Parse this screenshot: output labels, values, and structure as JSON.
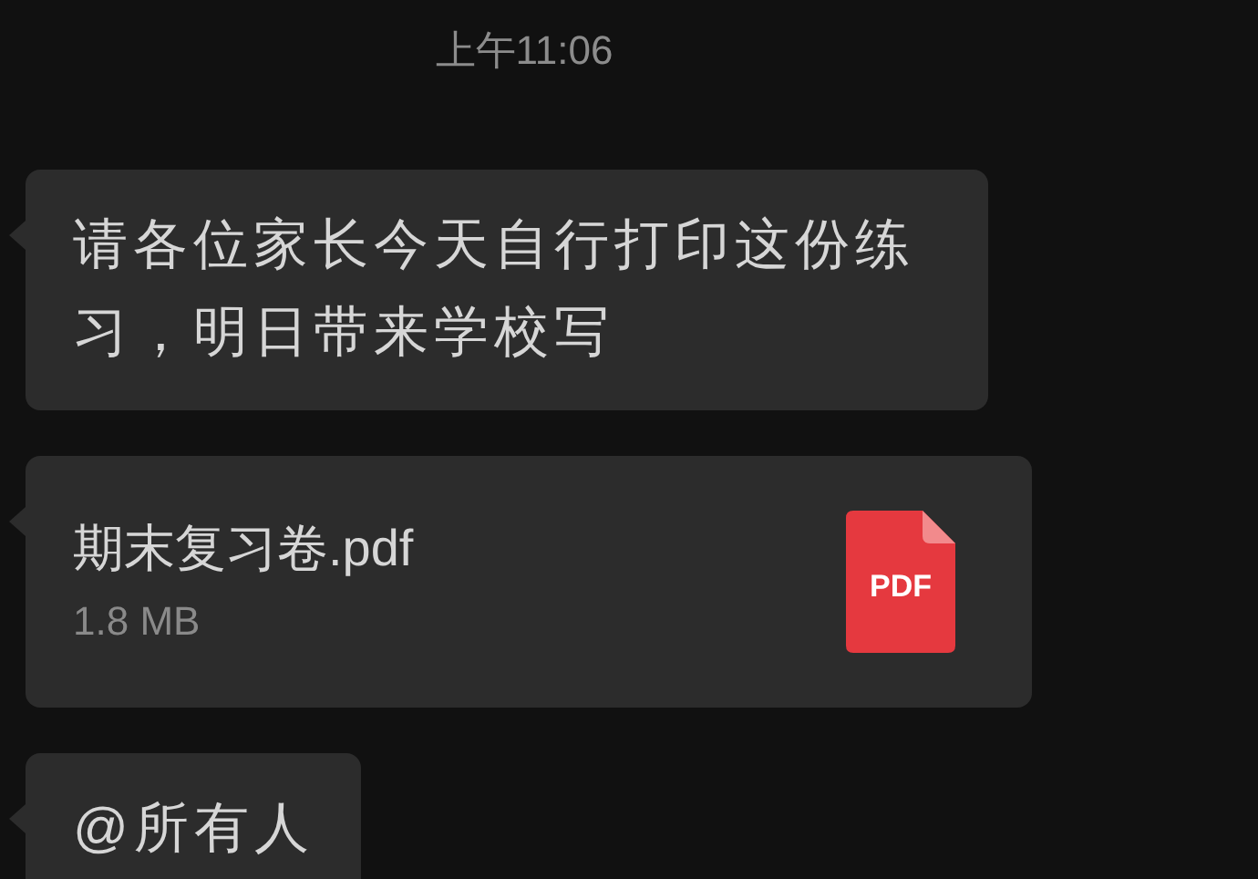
{
  "timestamp": "上午11:06",
  "messages": [
    {
      "kind": "text",
      "text": "请各位家长今天自行打印这份练习，明日带来学校写"
    },
    {
      "kind": "file",
      "file_name": "期末复习卷.pdf",
      "file_size": "1.8 MB",
      "icon_label": "PDF"
    },
    {
      "kind": "text",
      "text": "@所有人"
    }
  ]
}
